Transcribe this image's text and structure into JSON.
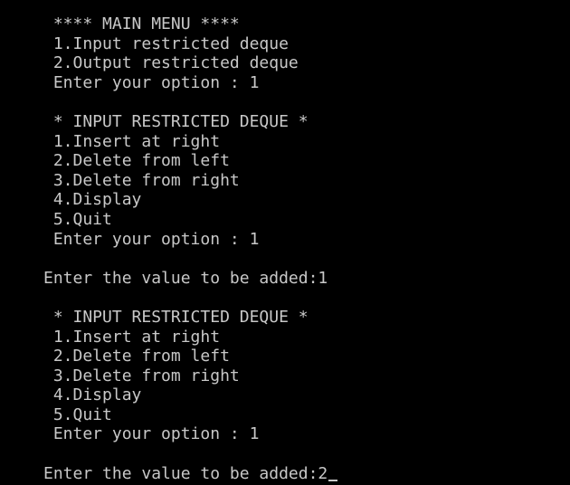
{
  "terminal": {
    "lines": [
      " **** MAIN MENU ****",
      " 1.Input restricted deque",
      " 2.Output restricted deque",
      " Enter your option : 1",
      "",
      " * INPUT RESTRICTED DEQUE *",
      " 1.Insert at right",
      " 2.Delete from left",
      " 3.Delete from right",
      " 4.Display",
      " 5.Quit",
      " Enter your option : 1",
      "",
      "Enter the value to be added:1",
      "",
      " * INPUT RESTRICTED DEQUE *",
      " 1.Insert at right",
      " 2.Delete from left",
      " 3.Delete from right",
      " 4.Display",
      " 5.Quit",
      " Enter your option : 1",
      "",
      "Enter the value to be added:2"
    ]
  },
  "colors": {
    "background": "#000000",
    "foreground": "#c8c8c8"
  }
}
